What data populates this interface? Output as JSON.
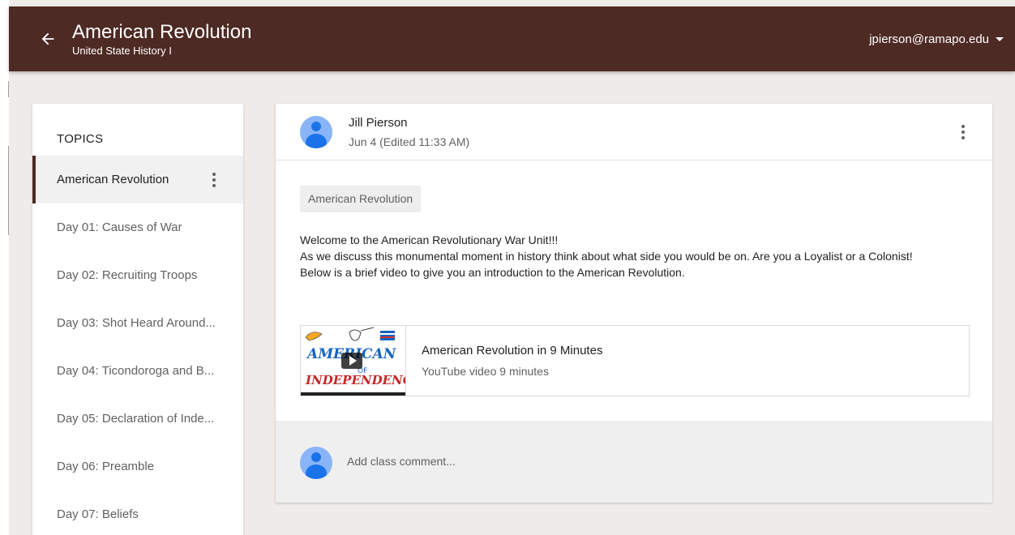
{
  "header": {
    "title": "American Revolution",
    "subtitle": "United State History I",
    "account": "jpierson@ramapo.edu",
    "back_icon": "arrow-back-icon",
    "colors": {
      "header_bg": "#4e2a24",
      "page_bg": "#efebe9"
    }
  },
  "sidebar": {
    "heading": "TOPICS",
    "items": [
      {
        "label": "American Revolution",
        "active": true
      },
      {
        "label": "Day 01: Causes of War"
      },
      {
        "label": "Day 02: Recruiting Troops"
      },
      {
        "label": "Day 03: Shot Heard Around..."
      },
      {
        "label": "Day 04: Ticondoroga and B..."
      },
      {
        "label": "Day 05: Declaration of Inde..."
      },
      {
        "label": "Day 06: Preamble"
      },
      {
        "label": "Day 07: Beliefs"
      }
    ]
  },
  "post": {
    "author": "Jill Pierson",
    "date": "Jun 4 (Edited 11:33 AM)",
    "topic_chip": "American Revolution",
    "body": [
      "Welcome to the American Revolutionary War Unit!!!",
      "As we discuss this monumental moment in history think about what side you would be on. Are you a Loyalist or a Colonist!",
      "Below is a brief video to give you an introduction to the American Revolution."
    ],
    "attachment": {
      "title": "American Revolution in 9 Minutes",
      "subtitle": "YouTube video 9 minutes",
      "thumb_text_top": "AMERICAN",
      "thumb_text_mid": "OF",
      "thumb_text_bottom": "INDEPENDENCE"
    },
    "comment_placeholder": "Add class comment..."
  }
}
